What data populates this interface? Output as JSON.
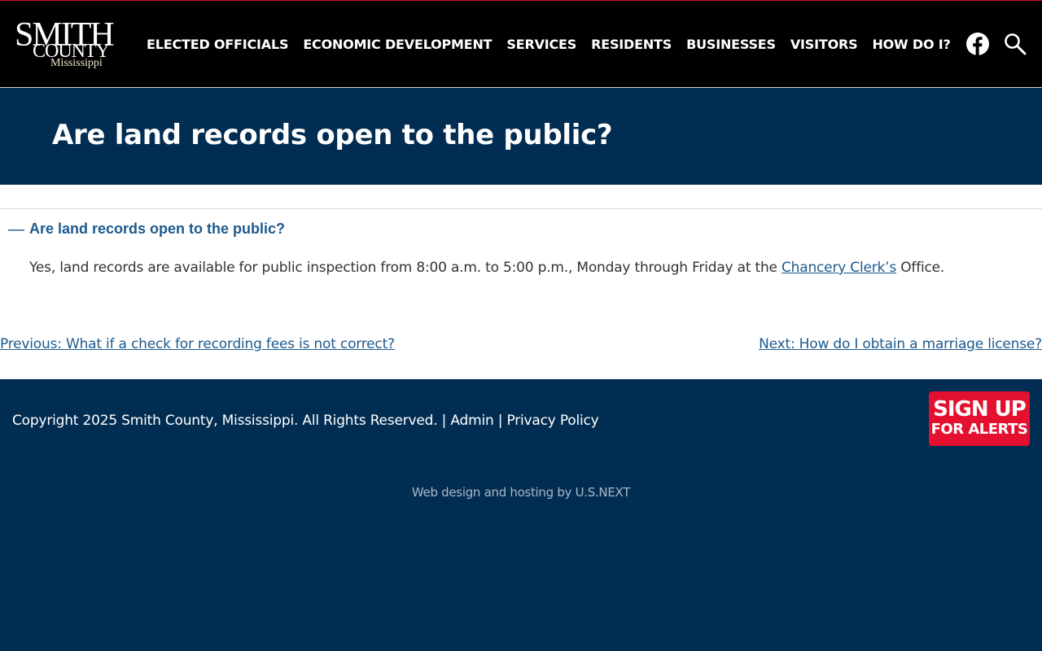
{
  "header": {
    "logo": {
      "line1": "SMITH",
      "line2": "COUNTY",
      "line3": "Mississippi"
    },
    "nav": [
      {
        "label": "ELECTED OFFICIALS"
      },
      {
        "label": "ECONOMIC DEVELOPMENT"
      },
      {
        "label": "SERVICES"
      },
      {
        "label": "RESIDENTS"
      },
      {
        "label": "BUSINESSES"
      },
      {
        "label": "VISITORS"
      },
      {
        "label": "HOW DO I?"
      }
    ],
    "icons": {
      "facebook": "facebook-icon",
      "search": "search-icon"
    }
  },
  "page": {
    "title": "Are land records open to the public?"
  },
  "faq": {
    "question": "Are land records open to the public?",
    "toggle": "—",
    "answer_before": "Yes, land records are available for public inspection from 8:00 a.m. to 5:00 p.m., Monday through Friday at the ",
    "answer_link": "Chancery Clerk’s",
    "answer_after": " Office."
  },
  "pager": {
    "previous": "Previous: What if a check for recording fees is not correct?",
    "next": "Next: How do I obtain a marriage license?"
  },
  "footer": {
    "copyright": "Copyright 2025 Smith County, Mississippi. All Rights Reserved.",
    "sep1": " | ",
    "admin": "Admin",
    "sep2": " | ",
    "privacy": "Privacy Policy",
    "signup_line1": "SIGN UP",
    "signup_line2": "FOR ALERTS",
    "credit": "Web design and hosting by U.S.NEXT"
  },
  "colors": {
    "header_bg": "#000000",
    "navy": "#022d52",
    "link": "#1d5a8e",
    "signup_red": "#e4102f"
  }
}
